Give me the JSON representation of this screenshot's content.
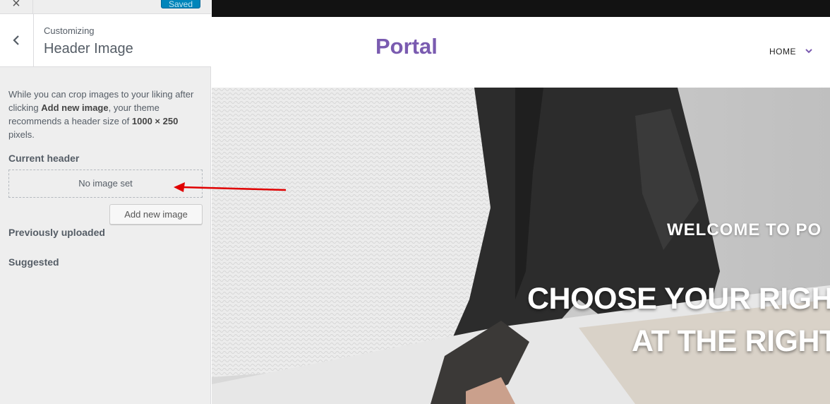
{
  "customizer": {
    "close_icon_glyph": "×",
    "save_button_label": "Saved",
    "section_small_label": "Customizing",
    "section_title": "Header Image",
    "description": {
      "part1": "While you can crop images to your liking after clicking ",
      "bold1": "Add new image",
      "part2": ", your theme recommends a header size of ",
      "bold2": "1000 × 250",
      "part3": " pixels."
    },
    "current_header_label": "Current header",
    "no_image_text": "No image set",
    "add_new_image_label": "Add new image",
    "previously_uploaded_label": "Previously uploaded",
    "suggested_label": "Suggested",
    "accent_color": "#0085ba"
  },
  "preview": {
    "site_title": "Portal",
    "nav": {
      "home_label": "HOME"
    },
    "hero": {
      "subtitle": "WELCOME TO PO",
      "headline_line1": "CHOOSE YOUR RIGH",
      "headline_line2": "AT THE RIGHT"
    },
    "brand_color": "#7a5bb0"
  },
  "annotation": {
    "arrow_color": "#e00000"
  }
}
